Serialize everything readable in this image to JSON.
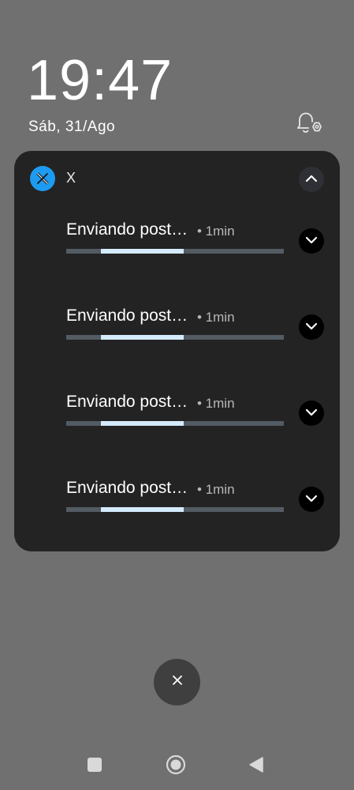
{
  "lockscreen": {
    "time": "19:47",
    "date": "Sáb, 31/Ago",
    "icons": {
      "bell": "bell-settings-icon"
    }
  },
  "notification_group": {
    "app_name": "X",
    "app_icon": "x-logo-icon",
    "accent_color": "#1d9bf0",
    "items": [
      {
        "title": "Enviando post…",
        "time": "• 1min",
        "progress": 0.38
      },
      {
        "title": "Enviando post…",
        "time": "• 1min",
        "progress": 0.38
      },
      {
        "title": "Enviando post…",
        "time": "• 1min",
        "progress": 0.38
      },
      {
        "title": "Enviando post…",
        "time": "• 1min",
        "progress": 0.38
      }
    ]
  },
  "clear_all": {
    "icon": "close-icon"
  },
  "navbar": {
    "icons": [
      "recents-icon",
      "home-icon",
      "back-icon"
    ]
  }
}
